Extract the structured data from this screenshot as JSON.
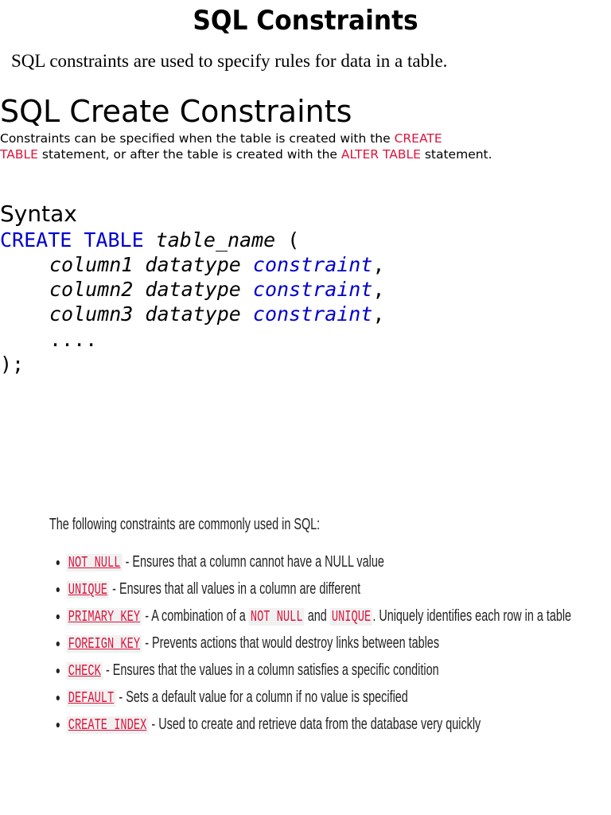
{
  "title": "SQL Constraints",
  "intro": "SQL constraints are used to specify rules for data in a table.",
  "create": {
    "heading": "SQL Create Constraints",
    "p1": "Constraints can be specified when the table is created with the ",
    "kw1a": "CREATE",
    "kw1b": "TABLE",
    "p2": " statement, or after the table is created with the ",
    "kw2": "ALTER TABLE",
    "p3": " statement."
  },
  "syntax": {
    "heading": "Syntax",
    "l1kw": "CREATE TABLE",
    "l1name": "table_name",
    "l1end": " (",
    "cols": [
      {
        "def": "column1 datatype",
        "c": "constraint"
      },
      {
        "def": "column2 datatype",
        "c": "constraint"
      },
      {
        "def": "column3 datatype",
        "c": "constraint"
      }
    ],
    "dots": "....",
    "close": ");"
  },
  "list": {
    "intro": "The following constraints are commonly used in SQL:",
    "items": [
      {
        "code": "NOT NULL",
        "desc": " - Ensures that a column cannot have a NULL value"
      },
      {
        "code": "UNIQUE",
        "desc": " - Ensures that all values in a column are different"
      },
      {
        "code": "PRIMARY KEY",
        "desc": " - A combination of a ",
        "c2": "NOT NULL",
        "mid": " and ",
        "c3": "UNIQUE",
        "end": ". Uniquely identifies each row in a table"
      },
      {
        "code": "FOREIGN KEY",
        "desc": " - Prevents actions that would destroy links between tables"
      },
      {
        "code": "CHECK",
        "desc": " - Ensures that the values in a column satisfies a specific condition"
      },
      {
        "code": "DEFAULT",
        "desc": " - Sets a default value for a column if no value is specified"
      },
      {
        "code": "CREATE INDEX",
        "desc": " - Used to create and retrieve data from the database very quickly"
      }
    ]
  }
}
